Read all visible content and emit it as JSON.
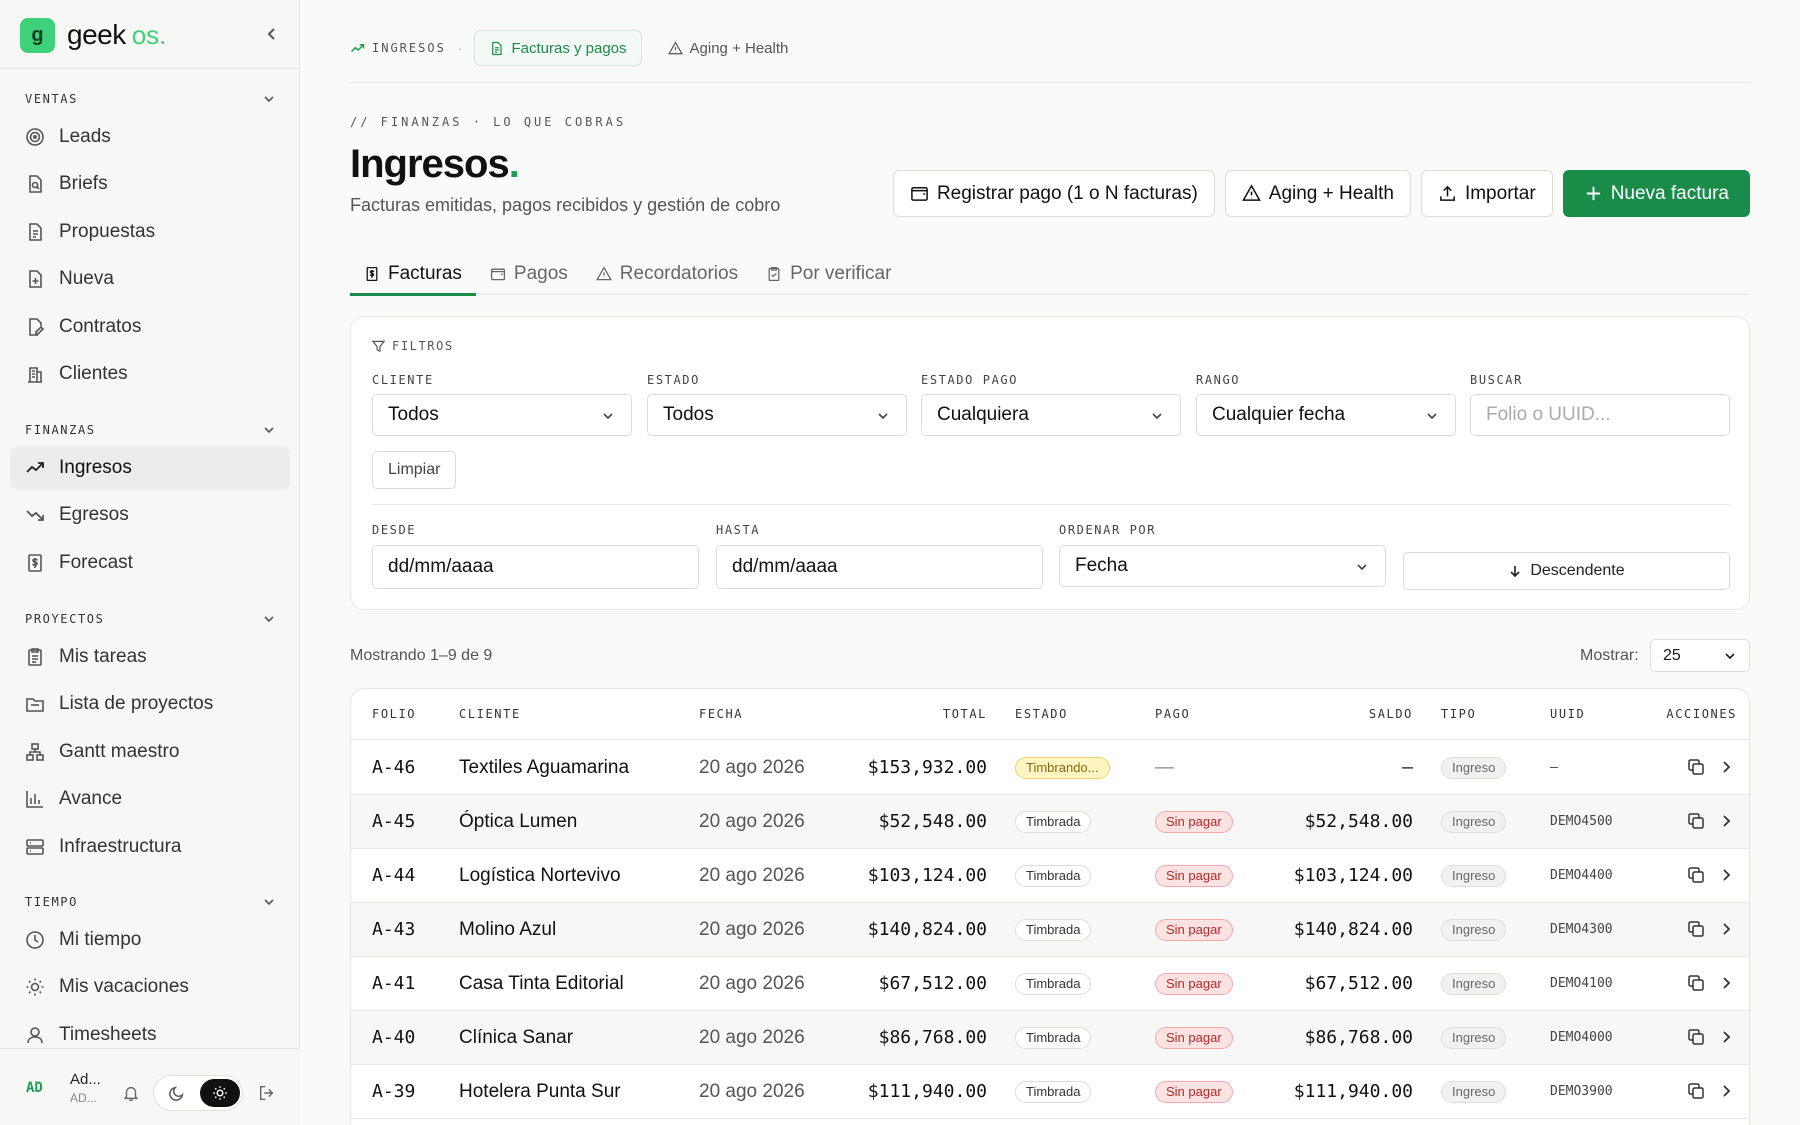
{
  "brand": {
    "name": "geek",
    "suffix": "os."
  },
  "sidebar": {
    "sections": [
      {
        "title": "VENTAS",
        "items": [
          "Leads",
          "Briefs",
          "Propuestas",
          "Nueva",
          "Contratos",
          "Clientes"
        ]
      },
      {
        "title": "FINANZAS",
        "items": [
          "Ingresos",
          "Egresos",
          "Forecast"
        ]
      },
      {
        "title": "PROYECTOS",
        "items": [
          "Mis tareas",
          "Lista de proyectos",
          "Gantt maestro",
          "Avance",
          "Infraestructura"
        ]
      },
      {
        "title": "TIEMPO",
        "items": [
          "Mi tiempo",
          "Mis vacaciones",
          "Timesheets"
        ]
      }
    ],
    "active_item": "Ingresos"
  },
  "user": {
    "initials": "AD",
    "name": "Ad...",
    "sub": "AD..."
  },
  "breadcrumb": {
    "root": "INGRESOS",
    "items": [
      "Facturas y pagos",
      "Aging + Health"
    ]
  },
  "header": {
    "eyebrow": "// FINANZAS · LO QUE COBRAS",
    "title": "Ingresos",
    "title_dot": ".",
    "subtitle": "Facturas emitidas, pagos recibidos y gestión de cobro"
  },
  "actions": {
    "register": "Registrar pago (1 o N facturas)",
    "aging": "Aging + Health",
    "import": "Importar",
    "new_invoice": "Nueva factura"
  },
  "tabs": [
    "Facturas",
    "Pagos",
    "Recordatorios",
    "Por verificar"
  ],
  "filters": {
    "title": "FILTROS",
    "cliente": {
      "label": "CLIENTE",
      "value": "Todos"
    },
    "estado": {
      "label": "ESTADO",
      "value": "Todos"
    },
    "estado_pago": {
      "label": "ESTADO PAGO",
      "value": "Cualquiera"
    },
    "rango": {
      "label": "RANGO",
      "value": "Cualquier fecha"
    },
    "buscar": {
      "label": "BUSCAR",
      "placeholder": "Folio o UUID..."
    },
    "clear": "Limpiar",
    "desde": {
      "label": "DESDE",
      "value": "dd/mm/aaaa"
    },
    "hasta": {
      "label": "HASTA",
      "value": "dd/mm/aaaa"
    },
    "ordenar": {
      "label": "ORDENAR POR",
      "value": "Fecha"
    },
    "direction": "Descendente"
  },
  "listing": {
    "showing": "Mostrando 1–9 de 9",
    "perpage_label": "Mostrar:",
    "perpage": "25"
  },
  "table": {
    "columns": [
      "FOLIO",
      "CLIENTE",
      "FECHA",
      "TOTAL",
      "ESTADO",
      "PAGO",
      "SALDO",
      "TIPO",
      "UUID",
      "ACCIONES"
    ],
    "rows": [
      {
        "folio": "A-46",
        "cliente": "Textiles Aguamarina",
        "fecha": "20 ago 2026",
        "total": "$153,932.00",
        "estado": "Timbrando...",
        "pago": "—",
        "saldo": "—",
        "tipo": "Ingreso",
        "uuid": "—"
      },
      {
        "folio": "A-45",
        "cliente": "Óptica Lumen",
        "fecha": "20 ago 2026",
        "total": "$52,548.00",
        "estado": "Timbrada",
        "pago": "Sin pagar",
        "saldo": "$52,548.00",
        "tipo": "Ingreso",
        "uuid": "DEMO4500"
      },
      {
        "folio": "A-44",
        "cliente": "Logística Nortevivo",
        "fecha": "20 ago 2026",
        "total": "$103,124.00",
        "estado": "Timbrada",
        "pago": "Sin pagar",
        "saldo": "$103,124.00",
        "tipo": "Ingreso",
        "uuid": "DEMO4400"
      },
      {
        "folio": "A-43",
        "cliente": "Molino Azul",
        "fecha": "20 ago 2026",
        "total": "$140,824.00",
        "estado": "Timbrada",
        "pago": "Sin pagar",
        "saldo": "$140,824.00",
        "tipo": "Ingreso",
        "uuid": "DEMO4300"
      },
      {
        "folio": "A-41",
        "cliente": "Casa Tinta Editorial",
        "fecha": "20 ago 2026",
        "total": "$67,512.00",
        "estado": "Timbrada",
        "pago": "Sin pagar",
        "saldo": "$67,512.00",
        "tipo": "Ingreso",
        "uuid": "DEMO4100"
      },
      {
        "folio": "A-40",
        "cliente": "Clínica Sanar",
        "fecha": "20 ago 2026",
        "total": "$86,768.00",
        "estado": "Timbrada",
        "pago": "Sin pagar",
        "saldo": "$86,768.00",
        "tipo": "Ingreso",
        "uuid": "DEMO4000"
      },
      {
        "folio": "A-39",
        "cliente": "Hotelera Punta Sur",
        "fecha": "20 ago 2026",
        "total": "$111,940.00",
        "estado": "Timbrada",
        "pago": "Sin pagar",
        "saldo": "$111,940.00",
        "tipo": "Ingreso",
        "uuid": "DEMO3900"
      }
    ]
  },
  "colors": {
    "accent": "#1a8c4a",
    "brand": "#3ed17a",
    "danger": "#b32828",
    "warning": "#ecd36a"
  }
}
